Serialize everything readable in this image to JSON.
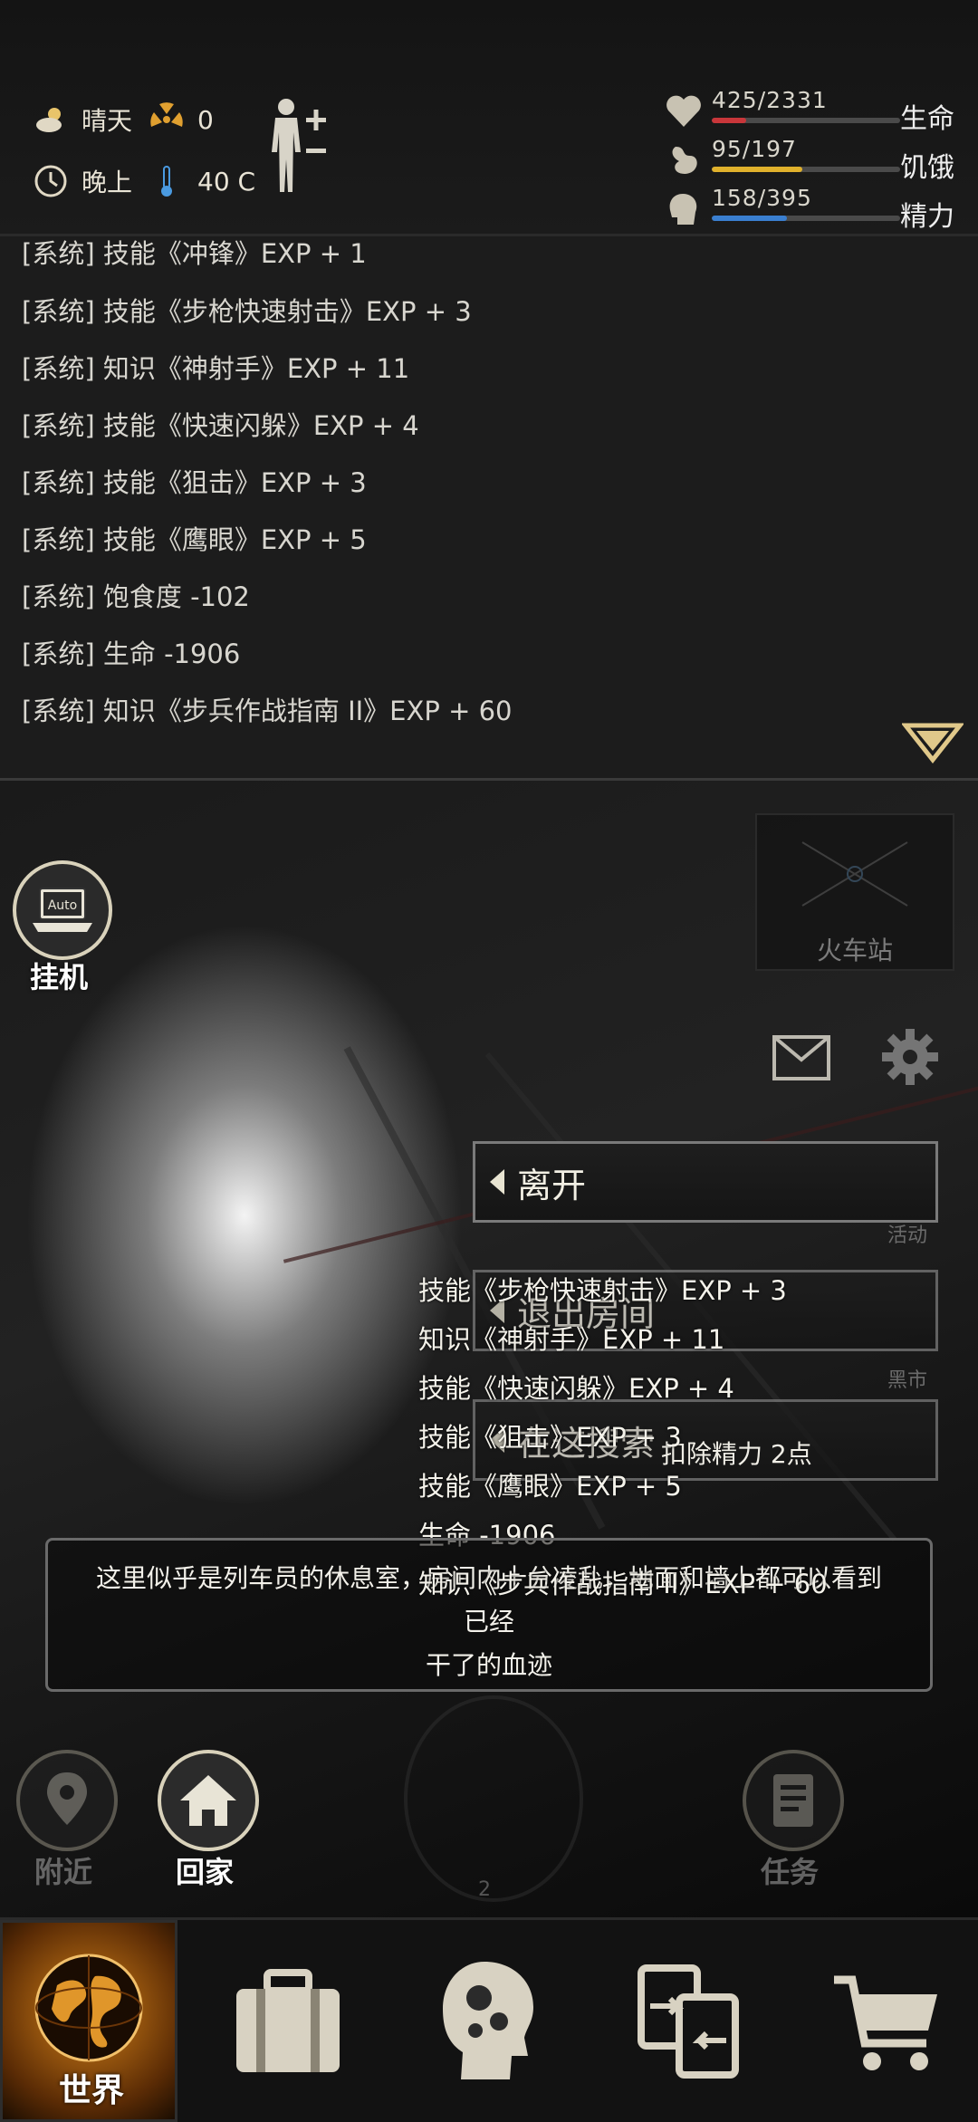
{
  "status": {
    "weather": "晴天",
    "radiation": "0",
    "time_of_day": "晚上",
    "temperature": "40 C",
    "stats": [
      {
        "value": "425/2331",
        "label": "生命",
        "fraction": 0.182,
        "color": "#c8363a",
        "icon": "heart-icon"
      },
      {
        "value": "95/197",
        "label": "饥饿",
        "fraction": 0.482,
        "color": "#e0b12c",
        "icon": "stomach-icon"
      },
      {
        "value": "158/395",
        "label": "精力",
        "fraction": 0.4,
        "color": "#3a7fd0",
        "icon": "head-icon"
      }
    ]
  },
  "log": [
    "[系统] 技能《冲锋》EXP + 1",
    "[系统] 技能《步枪快速射击》EXP + 3",
    "[系统] 知识《神射手》EXP + 11",
    "[系统] 技能《快速闪躲》EXP + 4",
    "[系统] 技能《狙击》EXP + 3",
    "[系统] 技能《鹰眼》EXP + 5",
    "[系统] 饱食度 -102",
    "[系统] 生命 -1906",
    "[系统] 知识《步兵作战指南 II》EXP + 60"
  ],
  "scene": {
    "auto_label": "挂机",
    "auto_badge": "Auto",
    "location_label": "火车站",
    "actions": {
      "leave": "离开",
      "exit_room": "退出房间",
      "search": "在这搜索",
      "search_cost": "扣除精力 2点"
    },
    "side_labels": {
      "activity": "活动",
      "black_market": "黑市"
    },
    "floating_exp": [
      "技能《步枪快速射击》EXP + 3",
      "知识《神射手》EXP + 11",
      "技能《快速闪躲》EXP + 4",
      "技能《狙击》EXP + 3",
      "技能《鹰眼》EXP + 5",
      "生命 -1906",
      "知识《步兵作战指南 II》EXP + 60"
    ],
    "description_line1": "这里似乎是列车员的休息室，房间内十分凌乱，地面和墙上都可以看到已经",
    "description_line2": "干了的血迹",
    "nearby": "附近",
    "home": "回家",
    "tasks": "任务",
    "radar_label": "2"
  },
  "nav": {
    "world": "世界"
  }
}
